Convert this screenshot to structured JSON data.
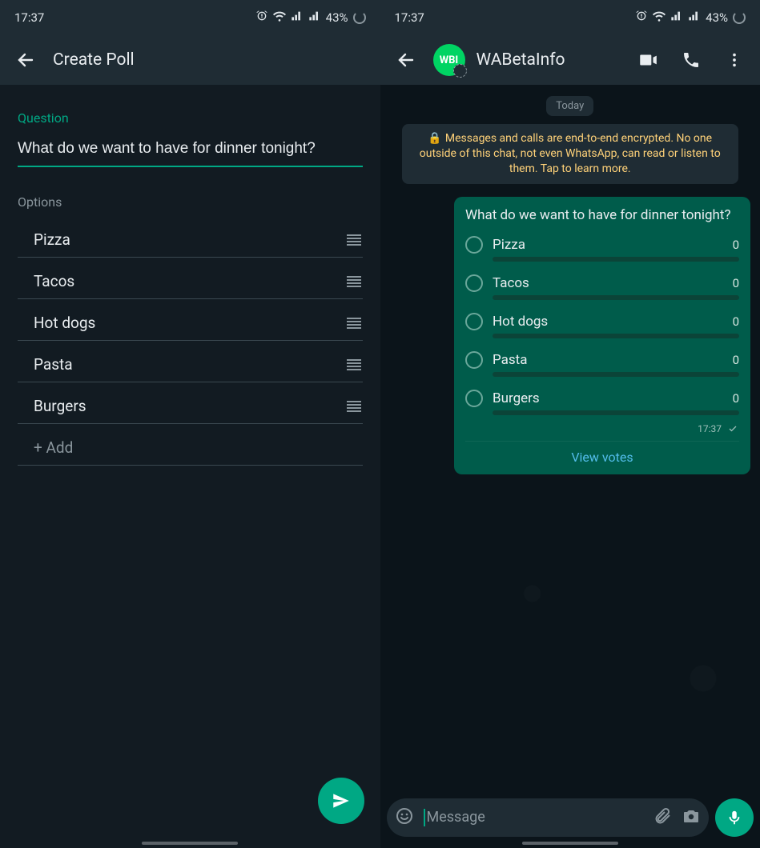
{
  "status": {
    "time": "17:37",
    "battery": "43%"
  },
  "left": {
    "title": "Create Poll",
    "question_label": "Question",
    "question_value": "What do we want to have for dinner tonight?",
    "options_label": "Options",
    "options": [
      {
        "label": "Pizza"
      },
      {
        "label": "Tacos"
      },
      {
        "label": "Hot dogs"
      },
      {
        "label": "Pasta"
      },
      {
        "label": "Burgers"
      }
    ],
    "add_label": "+ Add"
  },
  "right": {
    "chat_title": "WABetaInfo",
    "avatar_text": "WBI",
    "date_chip": "Today",
    "encryption_notice": "Messages and calls are end-to-end encrypted. No one outside of this chat, not even WhatsApp, can read or listen to them. Tap to learn more.",
    "poll": {
      "question": "What do we want to have for dinner tonight?",
      "options": [
        {
          "label": "Pizza",
          "votes": "0"
        },
        {
          "label": "Tacos",
          "votes": "0"
        },
        {
          "label": "Hot dogs",
          "votes": "0"
        },
        {
          "label": "Pasta",
          "votes": "0"
        },
        {
          "label": "Burgers",
          "votes": "0"
        }
      ],
      "time": "17:37",
      "view_votes": "View votes"
    },
    "input_placeholder": "Message"
  },
  "colors": {
    "accent": "#00A884",
    "bubble": "#005C4B",
    "bar": "#1F2C34",
    "bg_dark": "#121B22",
    "bg_chat": "#0B141A",
    "link": "#53BDEB",
    "notice_text": "#FFD279"
  }
}
